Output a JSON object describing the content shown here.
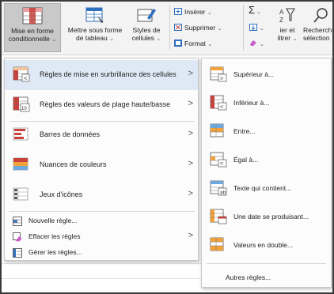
{
  "ribbon": {
    "cond_format": {
      "line1": "Mise en forme",
      "line2": "conditionnelle",
      "chev": "⌄"
    },
    "table_format": {
      "line1": "Mettre sous forme",
      "line2": "de tableau",
      "chev": "⌄"
    },
    "cell_styles": {
      "line1": "Styles de",
      "line2": "cellules",
      "chev": "⌄"
    },
    "insert": "Insérer",
    "delete": "Supprimer",
    "format": "Format",
    "sum_symbol": "Σ",
    "sort_filter": {
      "line1": "ier et",
      "line2": "iltrer"
    },
    "find_select": {
      "line1": "Recherch",
      "line2": "sélection"
    }
  },
  "main_menu": {
    "items": [
      {
        "label": "Règles de mise en surbrillance des cellules",
        "icon": "highlight-rules-icon",
        "arrow": ">"
      },
      {
        "label": "Règles des valeurs de plage haute/basse",
        "icon": "top-bottom-rules-icon",
        "arrow": ">"
      },
      {
        "label": "Barres de données",
        "icon": "data-bars-icon",
        "arrow": ">"
      },
      {
        "label": "Nuances de couleurs",
        "icon": "color-scales-icon",
        "arrow": ">"
      },
      {
        "label": "Jeux d'icônes",
        "icon": "icon-sets-icon",
        "arrow": ">"
      }
    ],
    "small_items": [
      {
        "label": "Nouvelle règle...",
        "icon": "new-rule-icon"
      },
      {
        "label": "Effacer les règles",
        "icon": "clear-rules-icon",
        "arrow": ">"
      },
      {
        "label": "Gérer les règles...",
        "icon": "manage-rules-icon"
      }
    ]
  },
  "sub_menu": {
    "items": [
      {
        "label": "Supérieur à...",
        "icon": "greater-than-icon"
      },
      {
        "label": "Inférieur à...",
        "icon": "less-than-icon"
      },
      {
        "label": "Entre...",
        "icon": "between-icon"
      },
      {
        "label": "Égal à...",
        "icon": "equal-to-icon"
      },
      {
        "label": "Texte qui contient...",
        "icon": "text-contains-icon"
      },
      {
        "label": "Une date se produisant...",
        "icon": "date-occurring-icon"
      },
      {
        "label": "Valeurs en double...",
        "icon": "duplicate-values-icon"
      }
    ],
    "more": "Autres règles..."
  },
  "colors": {
    "highlight": "#dfe9f5",
    "accent_blue": "#2f6fbf",
    "accent_red": "#c8413a",
    "accent_orange": "#f2a23a"
  }
}
